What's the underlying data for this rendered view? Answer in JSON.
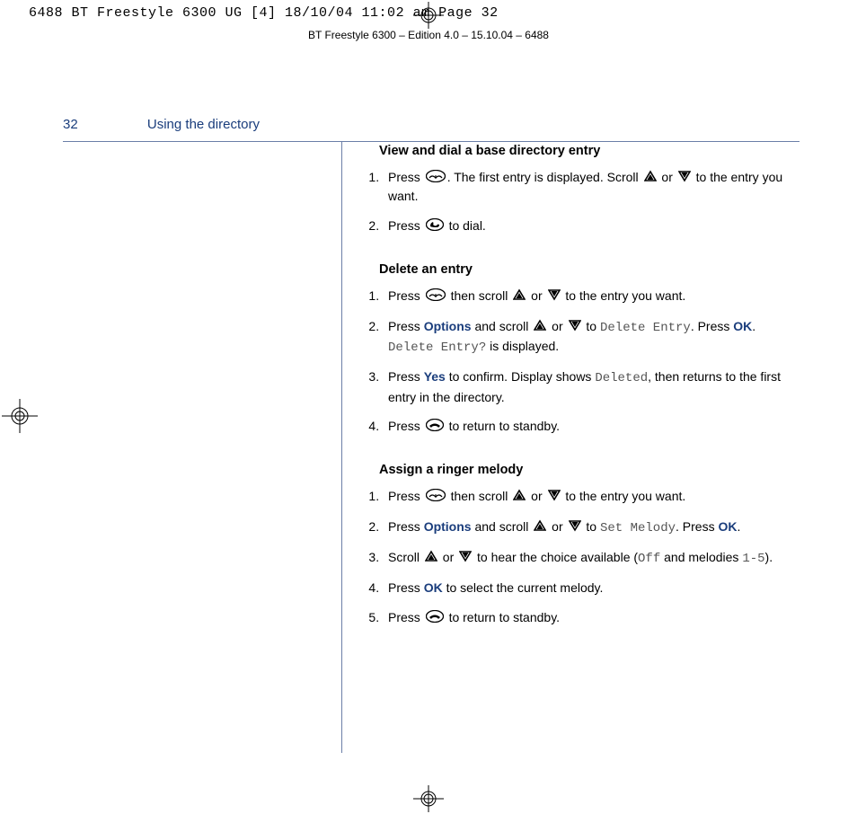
{
  "print_header": "6488 BT Freestyle 6300 UG [4]  18/10/04  11:02 am  Page 32",
  "edition_line": "BT Freestyle 6300 – Edition 4.0 – 15.10.04 – 6488",
  "page_number": "32",
  "section_title": "Using the directory",
  "sections": [
    {
      "heading": "View and dial a base directory entry",
      "steps": [
        {
          "pre": "Press ",
          "icon": "book",
          "post": ". The first entry is displayed. Scroll ",
          "icon2": "up",
          "mid": " or ",
          "icon3": "down",
          "post2": " to the entry you want."
        },
        {
          "pre": "Press ",
          "icon": "talk",
          "post": " to dial."
        }
      ]
    },
    {
      "heading": "Delete an entry",
      "steps": [
        {
          "pre": "Press ",
          "icon": "book",
          "post": " then scroll ",
          "icon2": "up",
          "mid": " or ",
          "icon3": "down",
          "post2": " to the entry you want."
        },
        {
          "pre": "Press ",
          "opt1": "Options",
          "post": " and scroll ",
          "icon2": "up",
          "mid": " or ",
          "icon3": "down",
          "post2": " to ",
          "lcd1": "Delete Entry",
          "post3": ". Press ",
          "opt2": "OK",
          "post4": ". ",
          "lcd2": "Delete Entry?",
          "post5": " is displayed."
        },
        {
          "pre": "Press ",
          "opt1": "Yes",
          "post": " to confirm. Display shows ",
          "lcd1": "Deleted",
          "post2": ", then returns to the first entry in the directory."
        },
        {
          "pre": "Press ",
          "icon": "end",
          "post": " to return to standby."
        }
      ]
    },
    {
      "heading": "Assign a ringer melody",
      "steps": [
        {
          "pre": "Press ",
          "icon": "book",
          "post": " then scroll ",
          "icon2": "up",
          "mid": " or ",
          "icon3": "down",
          "post2": " to the entry you want."
        },
        {
          "pre": "Press ",
          "opt1": "Options",
          "post": " and scroll ",
          "icon2": "up",
          "mid": " or ",
          "icon3": "down",
          "post2": " to ",
          "lcd1": "Set Melody",
          "post3": ". Press ",
          "opt2": "OK",
          "post4": "."
        },
        {
          "pre": "Scroll ",
          "icon": "up",
          "mid": " or ",
          "icon2": "down",
          "post": " to hear the choice available (",
          "lcd1": "Off",
          "post2": " and melodies ",
          "lcd2": "1-5",
          "post3": ")."
        },
        {
          "pre": "Press ",
          "opt1": "OK",
          "post": " to select the current melody."
        },
        {
          "pre": "Press ",
          "icon": "end",
          "post": " to return to standby."
        }
      ]
    }
  ]
}
